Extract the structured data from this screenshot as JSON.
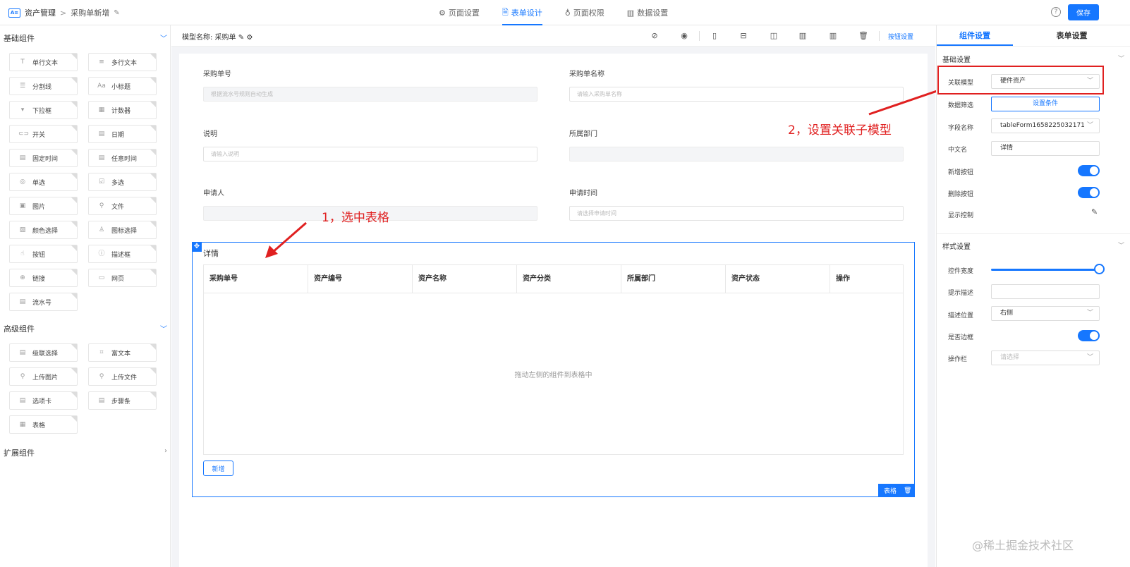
{
  "topbar": {
    "app_icon": "A≡",
    "app_name": "资产管理",
    "separator": ">",
    "page": "采购单新增",
    "tabs": [
      {
        "icon": "⚙",
        "label": "页面设置"
      },
      {
        "icon": "🗎",
        "label": "表单设计"
      },
      {
        "icon": "♁",
        "label": "页面权限"
      },
      {
        "icon": "▥",
        "label": "数据设置"
      }
    ],
    "help": "?",
    "save_label": "保存"
  },
  "left": {
    "basic_title": "基础组件",
    "basic": [
      {
        "icon": "T",
        "label": "单行文本"
      },
      {
        "icon": "≡",
        "label": "多行文本"
      },
      {
        "icon": "☰",
        "label": "分割线"
      },
      {
        "icon": "Aa",
        "label": "小标题"
      },
      {
        "icon": "▾",
        "label": "下拉框"
      },
      {
        "icon": "▦",
        "label": "计数器"
      },
      {
        "icon": "⊂⊃",
        "label": "开关"
      },
      {
        "icon": "▤",
        "label": "日期"
      },
      {
        "icon": "▤",
        "label": "固定时间"
      },
      {
        "icon": "▤",
        "label": "任意时间"
      },
      {
        "icon": "◎",
        "label": "单选"
      },
      {
        "icon": "☑",
        "label": "多选"
      },
      {
        "icon": "▣",
        "label": "图片"
      },
      {
        "icon": "⚲",
        "label": "文件"
      },
      {
        "icon": "▧",
        "label": "颜色选择"
      },
      {
        "icon": "♙",
        "label": "图标选择"
      },
      {
        "icon": "☝",
        "label": "按钮"
      },
      {
        "icon": "ⓘ",
        "label": "描述框"
      },
      {
        "icon": "⊕",
        "label": "链接"
      },
      {
        "icon": "▭",
        "label": "网页"
      },
      {
        "icon": "▤",
        "label": "流水号"
      }
    ],
    "advanced_title": "高级组件",
    "advanced": [
      {
        "icon": "▤",
        "label": "级联选择"
      },
      {
        "icon": "⌗",
        "label": "富文本"
      },
      {
        "icon": "⚲",
        "label": "上传图片"
      },
      {
        "icon": "⚲",
        "label": "上传文件"
      },
      {
        "icon": "▤",
        "label": "选项卡"
      },
      {
        "icon": "▤",
        "label": "步骤条"
      },
      {
        "icon": "▦",
        "label": "表格"
      }
    ],
    "extend_title": "扩展组件"
  },
  "canvas": {
    "model_label": "模型名称: 采购单",
    "tools": [
      "⊘",
      "◉",
      "▯",
      "⊟",
      "◫",
      "▥",
      "▥",
      "🗑"
    ],
    "button_setting": "按钮设置",
    "fields": [
      {
        "label": "采购单号",
        "placeholder": "根据流水号规则自动生成",
        "disabled": true
      },
      {
        "label": "采购单名称",
        "placeholder": "请输入采购单名称",
        "disabled": false
      },
      {
        "label": "说明",
        "placeholder": "请输入说明",
        "disabled": false
      },
      {
        "label": "所属部门",
        "placeholder": "",
        "disabled": true
      },
      {
        "label": "申请人",
        "placeholder": "",
        "disabled": true
      },
      {
        "label": "申请时间",
        "placeholder": "请选择申请时间",
        "disabled": false
      }
    ],
    "table": {
      "title": "详情",
      "columns": [
        "采购单号",
        "资产编号",
        "资产名称",
        "资产分类",
        "所属部门",
        "资产状态",
        "操作"
      ],
      "empty_tip": "拖动左侧的组件到表格中",
      "add_label": "新增",
      "tag_label": "表格"
    }
  },
  "annotations": {
    "step1": "1，选中表格",
    "step2": "2，设置关联子模型"
  },
  "right": {
    "tabs": [
      "组件设置",
      "表单设置"
    ],
    "basic_title": "基础设置",
    "rows": {
      "model_label": "关联模型",
      "model_value": "硬件资产",
      "filter_label": "数据筛选",
      "filter_btn": "设置条件",
      "field_label": "字段名称",
      "field_value": "tableForm1658225032171",
      "cn_label": "中文名",
      "cn_value": "详情",
      "add_label": "新增按钮",
      "del_label": "删除按钮",
      "display_label": "显示控制"
    },
    "style_title": "样式设置",
    "style": {
      "width_label": "控件宽度",
      "width_value": 1.0,
      "desc_label": "提示描述",
      "desc_value": "",
      "pos_label": "描述位置",
      "pos_value": "右侧",
      "border_label": "是否边框",
      "ops_label": "操作栏",
      "ops_placeholder": "请选择"
    }
  },
  "watermark": "@稀土掘金技术社区",
  "colors": {
    "primary": "#1677ff",
    "annotation": "#e02020"
  }
}
